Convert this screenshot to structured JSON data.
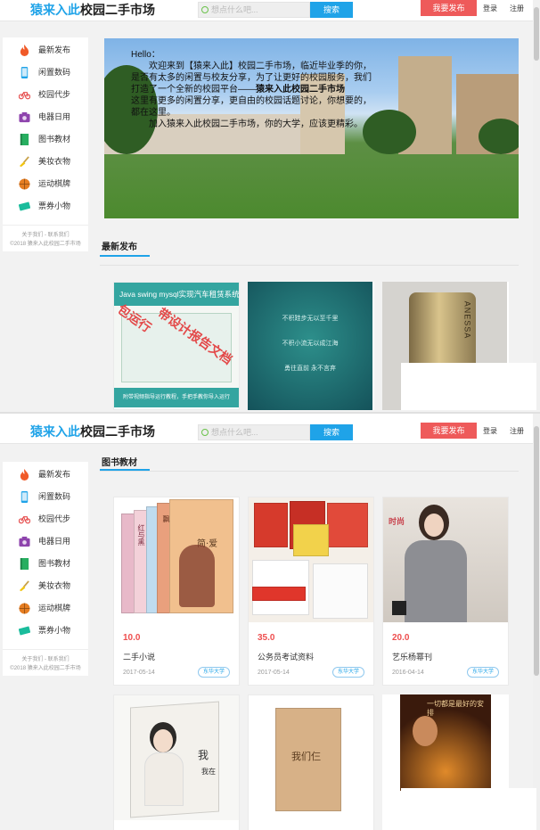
{
  "header": {
    "logo_part1": "猿来入此",
    "logo_part2": "校园二手市场",
    "search_placeholder": "想点什么吧...",
    "search_button": "搜索",
    "publish_button": "我要发布",
    "login": "登录",
    "register": "注册"
  },
  "sidebar": {
    "items": [
      {
        "label": "最新发布",
        "icon": "flame-icon",
        "color": "#f05a28"
      },
      {
        "label": "闲置数码",
        "icon": "phone-icon",
        "color": "#1fa3e8"
      },
      {
        "label": "校园代步",
        "icon": "bicycle-icon",
        "color": "#e54b4b"
      },
      {
        "label": "电器日用",
        "icon": "camera-icon",
        "color": "#8e44ad"
      },
      {
        "label": "图书教材",
        "icon": "book-icon",
        "color": "#27ae60"
      },
      {
        "label": "美妆衣物",
        "icon": "brush-icon",
        "color": "#f1c40f"
      },
      {
        "label": "运动棋牌",
        "icon": "basketball-icon",
        "color": "#e67e22"
      },
      {
        "label": "票券小物",
        "icon": "ticket-icon",
        "color": "#1abc9c"
      }
    ],
    "footer_line1": "关于我们 - 联系我们",
    "footer_line2": "©2018 猿来入此校园二手市场"
  },
  "banner": {
    "greeting": "Hello：",
    "line1": "欢迎来到【猿来入此】校园二手市场，临近毕业季的你，是否有太多的闲置与校友分享，为了让更好的校园服务，我们打造了一个全新的校园平台——",
    "line1_strong": "猿来入此校园二手市场",
    "line2": "这里有更多的闲置分享，更自由的校园话题讨论，你想要的，都在这里。",
    "line3": "加入猿来入此校园二手市场，你的大学，应该更精彩。"
  },
  "latest": {
    "title": "最新发布",
    "cards": [
      {
        "heading": "Java swing mysql实现汽车租赁系统",
        "overlay_a": "包运行",
        "overlay_b": "带设计报告文档",
        "footer": "附带视频指导运行教程，手把手教你导入运行"
      },
      {
        "line1": "不积跬步无以至千里",
        "line2": "不积小流无以成江海",
        "line3": "勇往直前 永不言弃"
      },
      {
        "brand": "ANESSA"
      }
    ]
  },
  "books": {
    "title": "图书教材",
    "cards": [
      {
        "price": "10.0",
        "name": "二手小说",
        "date": "2017-05-14",
        "school": "东华大学",
        "img_text_a": "简·爱",
        "img_text_b": "红与黑",
        "img_text_c": "飘"
      },
      {
        "price": "35.0",
        "name": "公务员考试资料",
        "date": "2017-05-14",
        "school": "东华大学"
      },
      {
        "price": "20.0",
        "name": "艺乐杨幂刊",
        "date": "2016-04-14",
        "school": "东华大学",
        "img_text_a": "时尚"
      },
      {
        "img_text_a": "我",
        "img_text_b": "我在"
      },
      {
        "img_text_a": "我们仨"
      },
      {
        "img_text_a": "一切都是最好的安排"
      }
    ]
  },
  "colors": {
    "accent": "#1fa3e8",
    "publish": "#ee5a5a",
    "price": "#ee4e4e"
  }
}
